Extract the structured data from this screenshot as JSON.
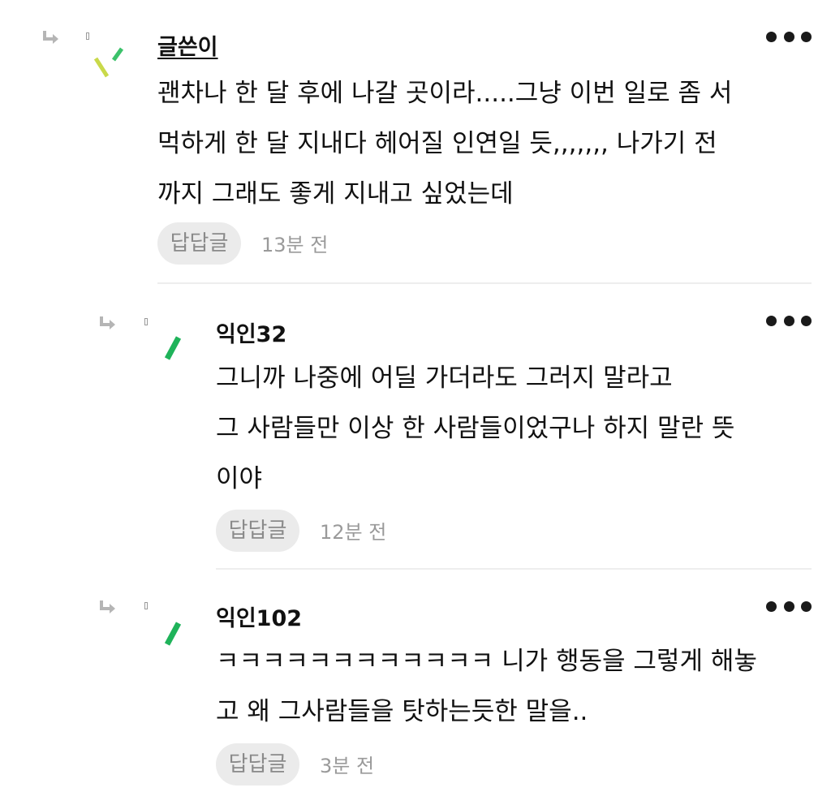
{
  "comments": [
    {
      "author": "글쓴이",
      "lines": [
        "괜차나 한 달 후에 나갈 곳이라.....그냥 이번 일로 좀 서",
        "먹하게 한 달 지내다 헤어질 인연일 듯,,,,,,, 나가기 전",
        "까지 그래도 좋게 지내고 싶었는데"
      ],
      "reply_label": "답답글",
      "time": "13분 전",
      "more_icon": "more-dots-icon"
    },
    {
      "author": "익인32",
      "lines": [
        "그니까 나중에 어딜 가더라도 그러지 말라고",
        "그 사람들만 이상 한 사람들이었구나 하지 말란 뜻",
        "이야"
      ],
      "reply_label": "답답글",
      "time": "12분 전",
      "more_icon": "more-dots-icon"
    },
    {
      "author": "익인102",
      "lines": [
        "ㅋㅋㅋㅋㅋㅋㅋㅋㅋㅋㅋㅋ 니가 행동을 그렇게 해놓",
        "고 왜 그사람들을 탓하는듯한 말을.."
      ],
      "reply_label": "답답글",
      "time": "3분 전",
      "more_icon": "more-dots-icon"
    }
  ],
  "colors": {
    "avatar_green": "#1fb35a",
    "avatar_lime": "#c9d94a",
    "avatar_green_light": "#3cc26b",
    "reply_button_bg": "#ebebeb",
    "muted_text": "#9a9a9a"
  }
}
